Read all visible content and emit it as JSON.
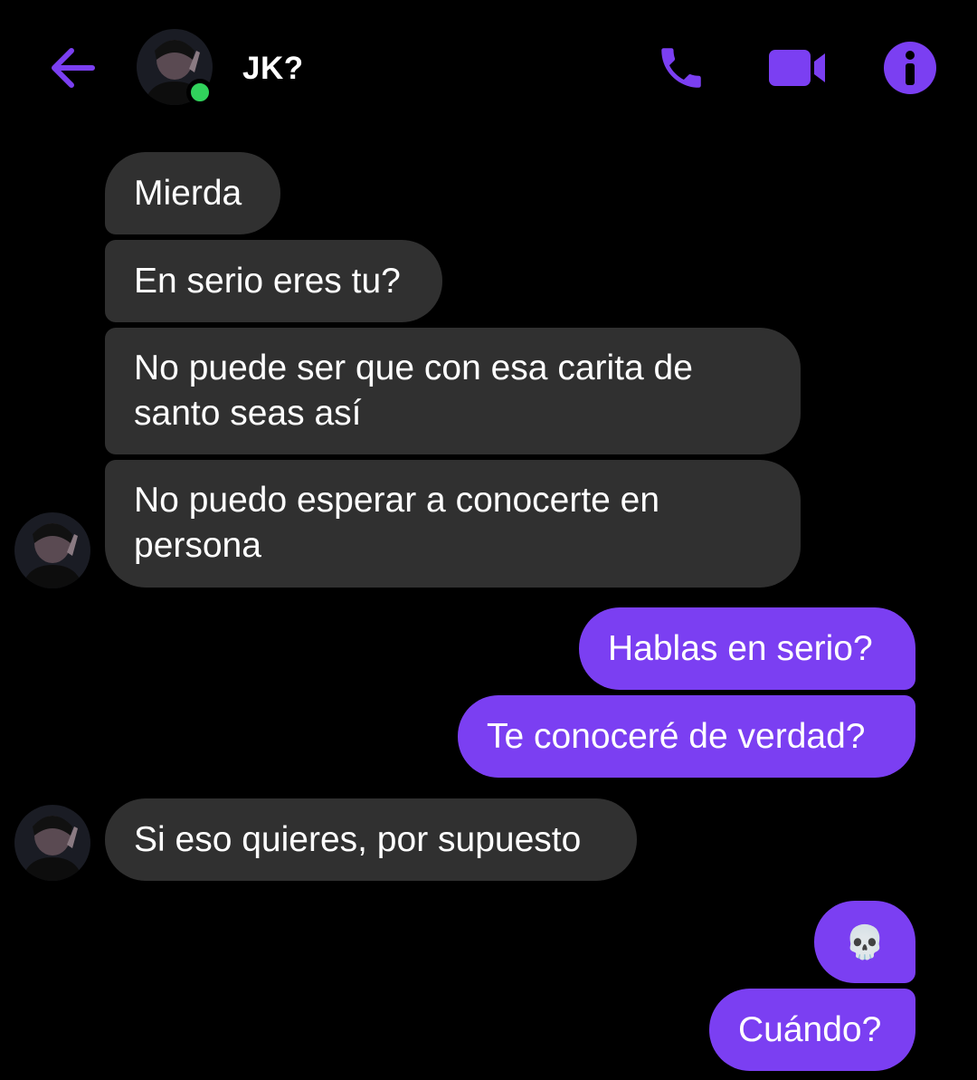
{
  "header": {
    "contact_name": "JK?",
    "online": true,
    "accent_color": "#7b3ff2",
    "icons": {
      "back": "arrow-left-icon",
      "call": "phone-icon",
      "video": "video-camera-icon",
      "info": "info-icon"
    }
  },
  "messages": [
    {
      "direction": "incoming",
      "text": "Mierda"
    },
    {
      "direction": "incoming",
      "text": "En serio eres tu?"
    },
    {
      "direction": "incoming",
      "text": "No puede ser que con esa carita de santo seas así"
    },
    {
      "direction": "incoming",
      "text": "No puedo esperar a conocerte en persona"
    },
    {
      "direction": "outgoing",
      "text": "Hablas en serio?"
    },
    {
      "direction": "outgoing",
      "text": "Te conoceré de verdad?"
    },
    {
      "direction": "incoming",
      "text": "Si eso quieres, por supuesto"
    },
    {
      "direction": "outgoing",
      "text": "💀"
    },
    {
      "direction": "outgoing",
      "text": "Cuándo?"
    }
  ],
  "colors": {
    "background": "#000000",
    "incoming_bubble": "#303030",
    "outgoing_bubble": "#7b3ff2",
    "online_indicator": "#31d35c"
  }
}
